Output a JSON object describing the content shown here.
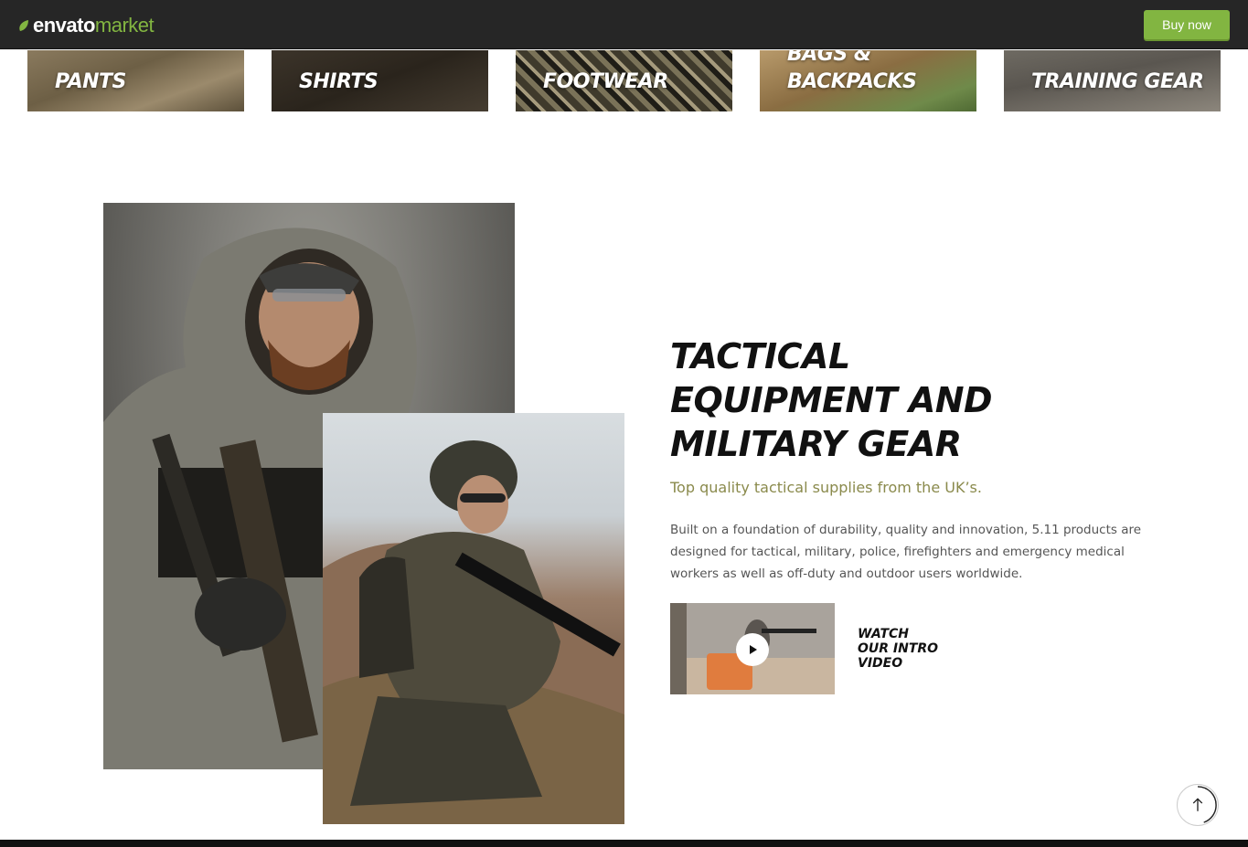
{
  "topbar": {
    "logo_envato": "envato",
    "logo_market": "market",
    "buy_label": "Buy now",
    "brand_color": "#82b541"
  },
  "categories": [
    {
      "label": "PANTS"
    },
    {
      "label": "SHIRTS"
    },
    {
      "label": "FOOTWEAR"
    },
    {
      "label": "BAGS &\nBACKPACKS"
    },
    {
      "label": "TRAINING GEAR"
    }
  ],
  "hero": {
    "heading_line1": "TACTICAL",
    "heading_line2": "EQUIPMENT AND",
    "heading_line3": "MILITARY GEAR",
    "subtitle": "Top quality tactical supplies from the UK’s.",
    "description": "Built on a foundation of durability, quality and innovation, 5.11 products are designed for tactical, military, police, firefighters and emergency medical workers as well as off-duty and outdoor users worldwide.",
    "subtitle_color": "#8a8a4c"
  },
  "video": {
    "watch_line1": "WATCH",
    "watch_line2": "OUR INTRO",
    "watch_line3": "VIDEO",
    "play_icon": "play-icon"
  },
  "scroll_top": {
    "icon": "arrow-up-icon"
  }
}
